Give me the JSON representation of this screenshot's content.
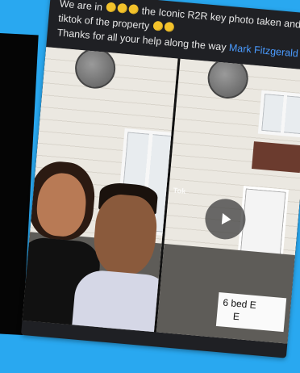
{
  "post": {
    "caption": {
      "line1_before_emoji": "We are in",
      "line1_after_emoji": "the Iconic R2R key photo taken and",
      "line2": "tiktok of the property",
      "line3_text": "Thanks for all your help along the way",
      "mention": "Mark Fitzgerald"
    },
    "video_label": {
      "line1": "6 bed E",
      "line2": "E"
    },
    "tiktok_watermark": "Tok"
  },
  "icons": {
    "emoji": "smiling-face-icon",
    "play": "play-icon"
  },
  "colors": {
    "background": "#29a8f0",
    "post_background": "#1f2024",
    "caption_text": "#e6e6e6",
    "mention": "#4a9bff"
  }
}
